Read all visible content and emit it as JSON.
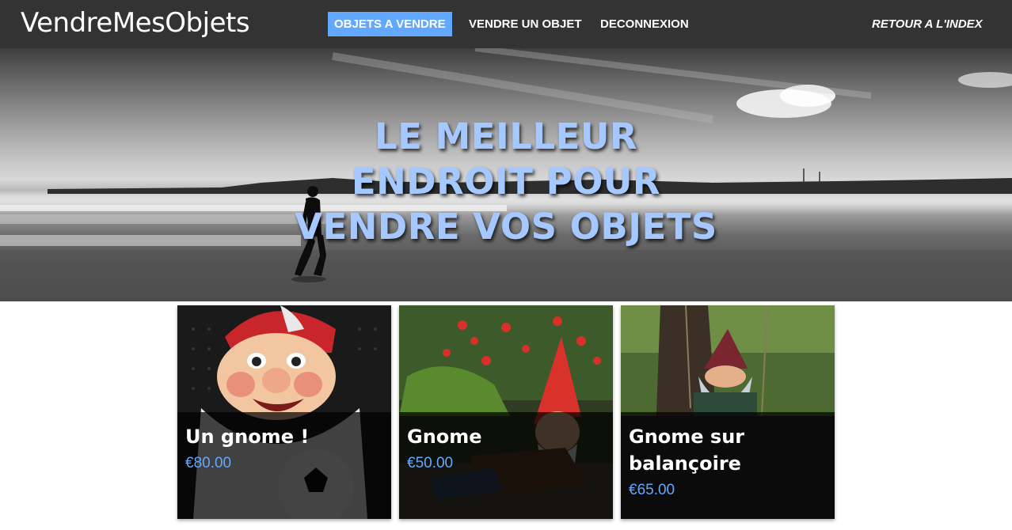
{
  "navbar": {
    "brand": "VendreMesObjets",
    "items": [
      {
        "label": "OBJETS A VENDRE",
        "active": true
      },
      {
        "label": "VENDRE UN OBJET",
        "active": false
      },
      {
        "label": "DECONNEXION",
        "active": false
      }
    ],
    "right_link": "RETOUR A L'INDEX"
  },
  "hero": {
    "lines": [
      "LE MEILLEUR",
      "ENDROIT POUR",
      "VENDRE VOS OBJETS"
    ]
  },
  "products": [
    {
      "title": "Un gnome !",
      "price": "€80.00"
    },
    {
      "title": "Gnome",
      "price": "€50.00"
    },
    {
      "title": "Gnome sur balançoire",
      "price": "€65.00"
    }
  ],
  "colors": {
    "navbar_bg": "#333333",
    "accent": "#62a8ff",
    "hero_text": "#a4c8ff"
  }
}
